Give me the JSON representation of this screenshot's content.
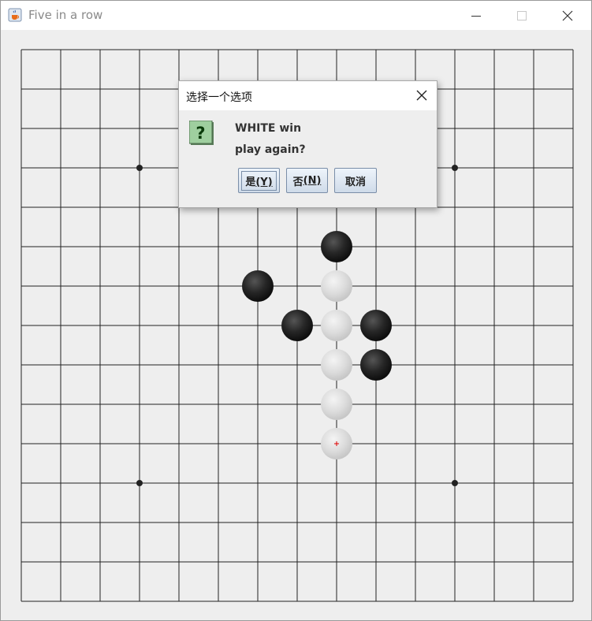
{
  "window": {
    "title": "Five in a row"
  },
  "dialog": {
    "title": "选择一个选项",
    "message_line1": "WHITE win",
    "message_line2": "play again?",
    "buttons": {
      "yes_label": "是",
      "yes_mnemonic": "(Y)",
      "no_label": "否",
      "no_mnemonic": "(N)",
      "cancel_label": "取消"
    }
  },
  "board": {
    "grid_lines": 15,
    "star_points": [
      [
        3,
        3
      ],
      [
        11,
        3
      ],
      [
        3,
        11
      ],
      [
        11,
        11
      ]
    ],
    "stones": [
      {
        "color": "black",
        "col": 8,
        "row": 5
      },
      {
        "color": "black",
        "col": 6,
        "row": 6
      },
      {
        "color": "white",
        "col": 8,
        "row": 6
      },
      {
        "color": "black",
        "col": 7,
        "row": 7
      },
      {
        "color": "white",
        "col": 8,
        "row": 7
      },
      {
        "color": "black",
        "col": 9,
        "row": 7
      },
      {
        "color": "white",
        "col": 8,
        "row": 8
      },
      {
        "color": "black",
        "col": 9,
        "row": 8
      },
      {
        "color": "white",
        "col": 8,
        "row": 9
      },
      {
        "color": "white",
        "col": 8,
        "row": 10
      }
    ],
    "last_move": {
      "col": 8,
      "row": 10
    },
    "colors": {
      "line": "#222222",
      "background": "#eeeeee",
      "last_move_marker": "#e00000"
    }
  },
  "icons": {
    "app": "java-cup-icon",
    "minimize": "minimize-icon",
    "maximize": "maximize-icon",
    "close": "close-icon",
    "question": "question-icon"
  }
}
